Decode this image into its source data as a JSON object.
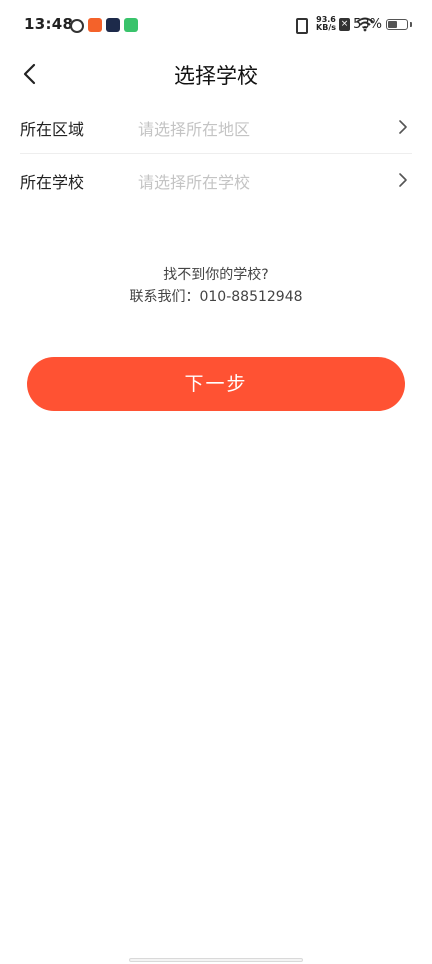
{
  "status_bar": {
    "time": "13:48",
    "notification_icons": [
      "swirl-icon",
      "orange-app-icon",
      "play-app-icon",
      "green-app-icon"
    ],
    "vibrate_icon": "vibrate-icon",
    "net_speed_value": "93.6",
    "net_speed_unit": "KB/s",
    "sim_icon": "no-sim-icon",
    "wifi_icon": "wifi-icon",
    "battery_text": "53%",
    "battery_level": 0.53
  },
  "nav": {
    "back_icon": "chevron-left-icon",
    "title": "选择学校"
  },
  "form": {
    "rows": [
      {
        "label": "所在区域",
        "placeholder": "请选择所在地区",
        "icon": "chevron-right-icon"
      },
      {
        "label": "所在学校",
        "placeholder": "请选择所在学校",
        "icon": "chevron-right-icon"
      }
    ]
  },
  "help": {
    "question": "找不到你的学校?",
    "contact": "联系我们：010-88512948"
  },
  "actions": {
    "next_label": "下一步"
  },
  "colors": {
    "accent": "#ff5233",
    "placeholder": "#c4c4c4",
    "divider": "#eeeeee"
  }
}
